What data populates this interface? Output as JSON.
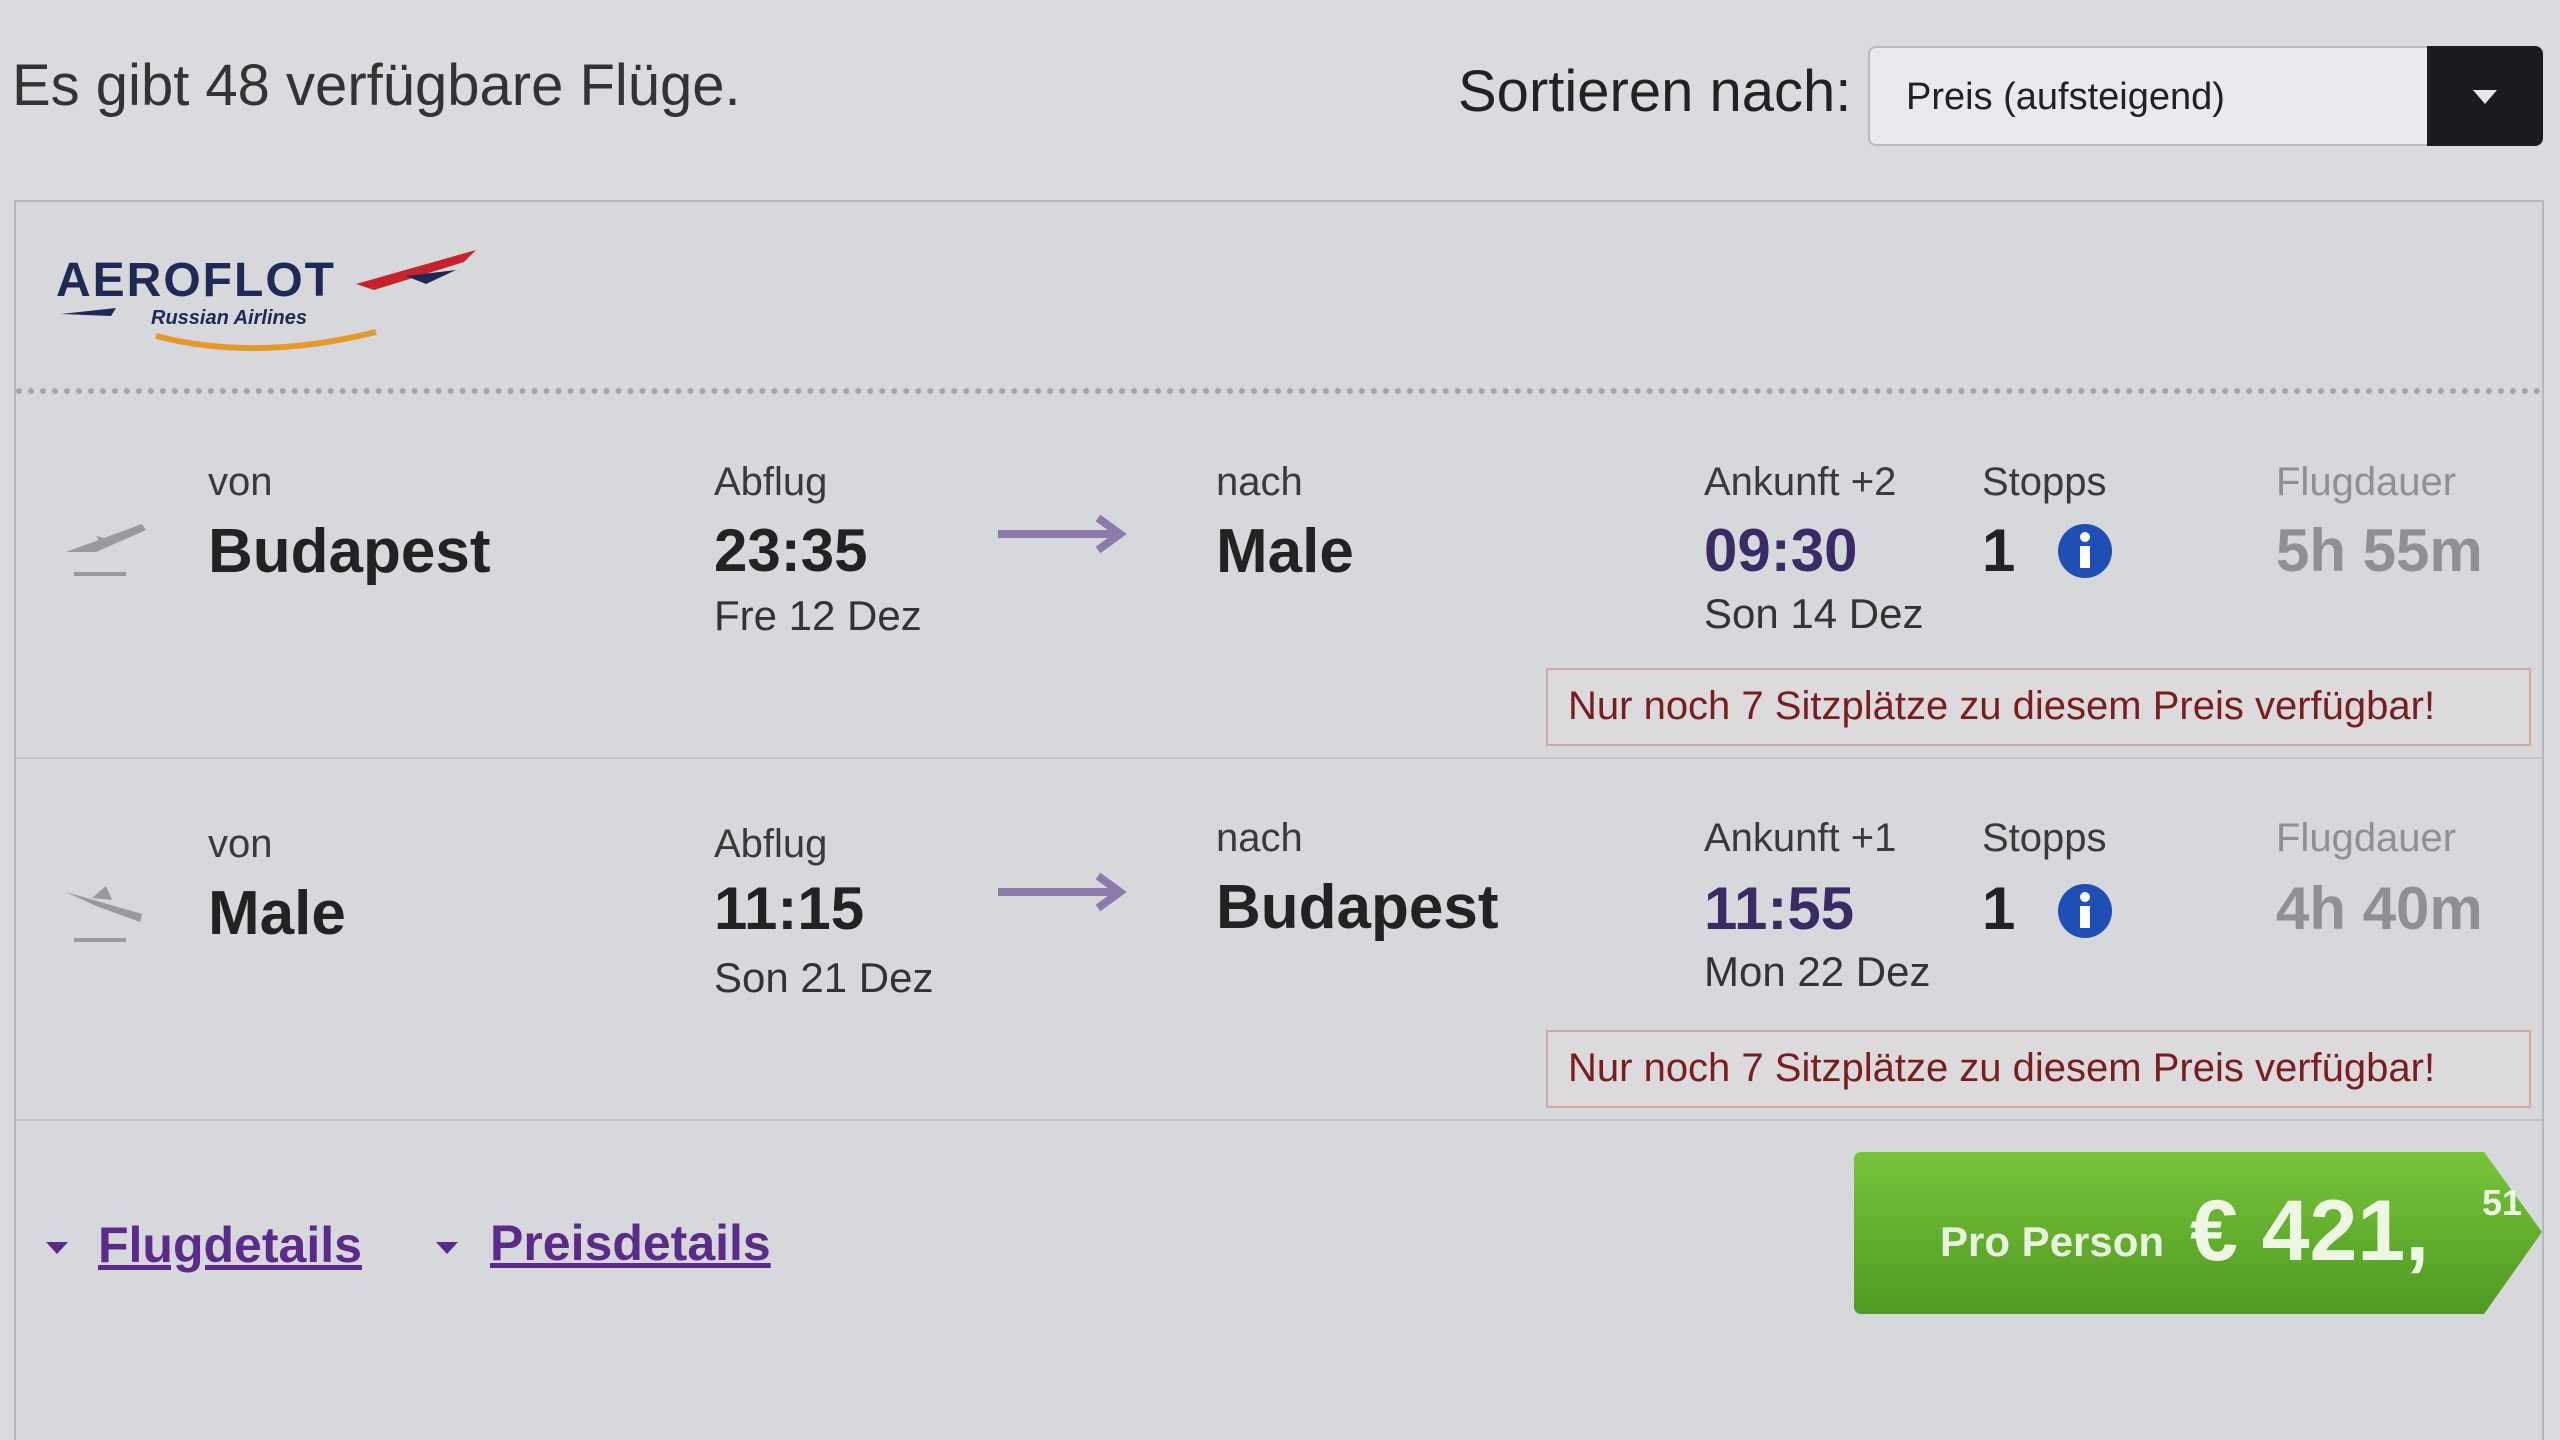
{
  "summary": {
    "count_text": "Es gibt 48 verfügbare Flüge."
  },
  "sort": {
    "label": "Sortieren nach:",
    "value": "Preis (aufsteigend)"
  },
  "airline": {
    "name": "AEROFLOT",
    "subtitle": "Russian Airlines"
  },
  "labels": {
    "from": "von",
    "departure": "Abflug",
    "to": "nach",
    "stops": "Stopps",
    "duration": "Flugdauer"
  },
  "legs": [
    {
      "from_city": "Budapest",
      "dep_time": "23:35",
      "dep_date": "Fre 12 Dez",
      "to_city": "Male",
      "arrival_label": "Ankunft +2",
      "arr_time": "09:30",
      "arr_date": "Son 14 Dez",
      "stops": "1",
      "duration": "5h 55m",
      "warning": "Nur noch 7 Sitzplätze zu diesem Preis verfügbar!"
    },
    {
      "from_city": "Male",
      "dep_time": "11:15",
      "dep_date": "Son 21 Dez",
      "to_city": "Budapest",
      "arrival_label": "Ankunft +1",
      "arr_time": "11:55",
      "arr_date": "Mon 22 Dez",
      "stops": "1",
      "duration": "4h 40m",
      "warning": "Nur noch 7 Sitzplätze zu diesem Preis verfügbar!"
    }
  ],
  "footer": {
    "flight_details": "Flugdetails",
    "price_details": "Preisdetails"
  },
  "price": {
    "label": "Pro Person",
    "value": "€ 421,",
    "cents": "51"
  },
  "colors": {
    "accent_link": "#5b2a8a",
    "price_green": "#5fae2c",
    "arrival_time": "#3a2b66",
    "warning_text": "#7a1d1d",
    "info_blue": "#1f4fb5"
  },
  "icons": {
    "leg1": "plane-departure-icon",
    "leg2": "plane-arrival-icon",
    "info": "info-icon",
    "sort": "chevron-down-icon"
  }
}
